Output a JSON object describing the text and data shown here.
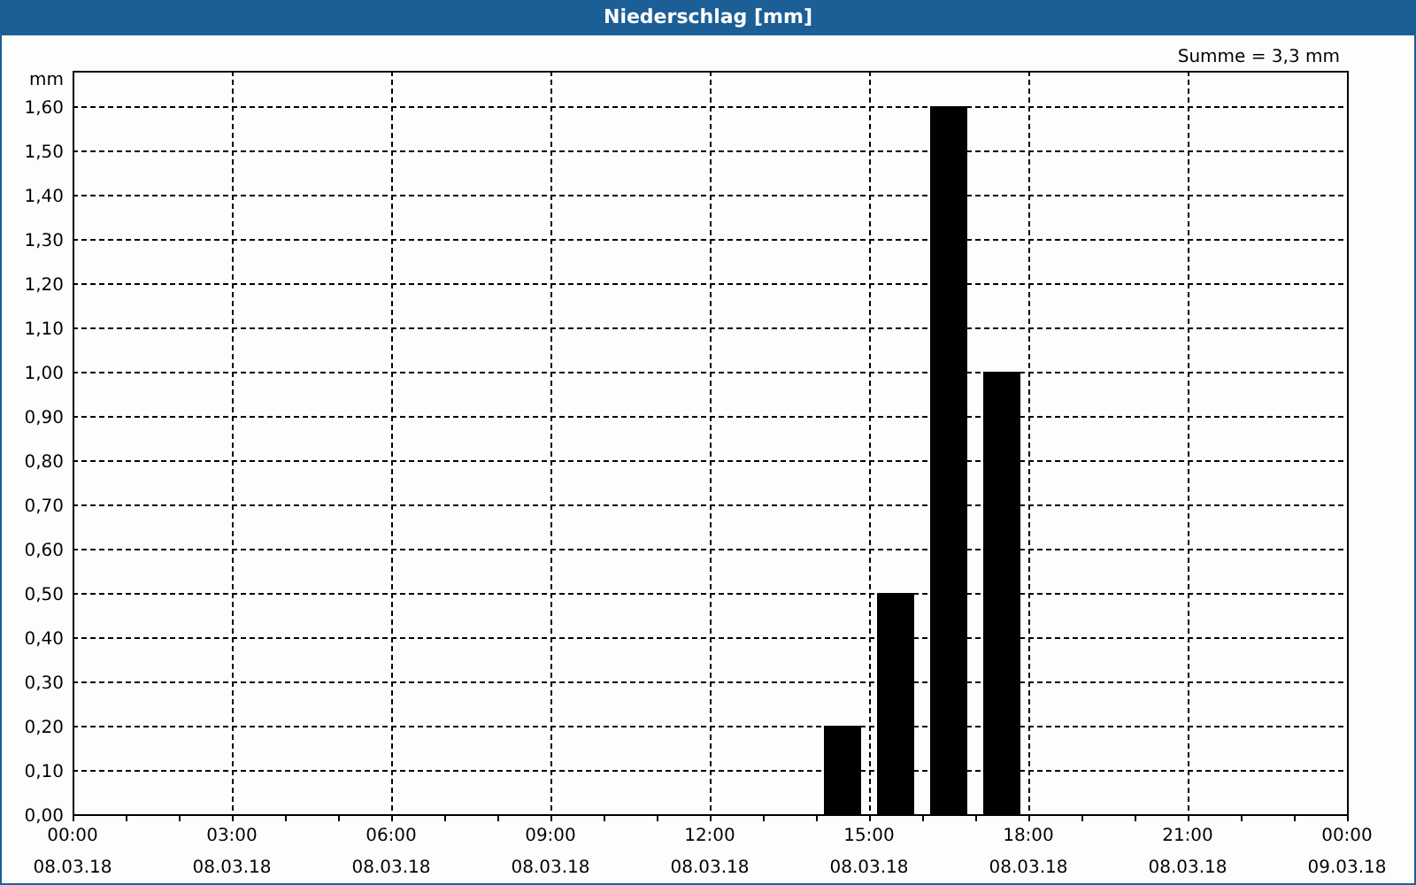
{
  "window": {
    "title": "Niederschlag [mm]"
  },
  "summary": "Summe = 3,3 mm",
  "chart_data": {
    "type": "bar",
    "grid": true,
    "ylabel": "mm",
    "categories": [
      "00:00 08.03.18",
      null,
      null,
      "03:00 08.03.18",
      null,
      null,
      "06:00 08.03.18",
      null,
      null,
      "09:00 08.03.18",
      null,
      null,
      "12:00 08.03.18",
      null,
      null,
      "15:00 08.03.18",
      null,
      null,
      "18:00 08.03.18",
      null,
      null,
      "21:00 08.03.18",
      null,
      null,
      "00:00 09.03.18"
    ],
    "series": [
      {
        "color": "#000000",
        "values": [
          null,
          null,
          null,
          null,
          null,
          null,
          null,
          null,
          null,
          null,
          null,
          null,
          null,
          null,
          0.2,
          0.5,
          1.6,
          1.0,
          null,
          null,
          null,
          null,
          null,
          null,
          null
        ]
      }
    ],
    "ylim": [
      0,
      1.68
    ],
    "yticks": [
      {
        "value": 0,
        "label": "0,00"
      },
      {
        "value": 0.1,
        "label": "0,10"
      },
      {
        "value": 0.2,
        "label": "0,20"
      },
      {
        "value": 0.3,
        "label": "0,30"
      },
      {
        "value": 0.4,
        "label": "0,40"
      },
      {
        "value": 0.5,
        "label": "0,50"
      },
      {
        "value": 0.6,
        "label": "0,60"
      },
      {
        "value": 0.7,
        "label": "0,70"
      },
      {
        "value": 0.8,
        "label": "0,80"
      },
      {
        "value": 0.9,
        "label": "0,90"
      },
      {
        "value": 1.0,
        "label": "1,00"
      },
      {
        "value": 1.1,
        "label": "1,10"
      },
      {
        "value": 1.2,
        "label": "1,20"
      },
      {
        "value": 1.3,
        "label": "1,30"
      },
      {
        "value": 1.4,
        "label": "1,40"
      },
      {
        "value": 1.5,
        "label": "1,50"
      },
      {
        "value": 1.6,
        "label": "1,60"
      }
    ]
  }
}
